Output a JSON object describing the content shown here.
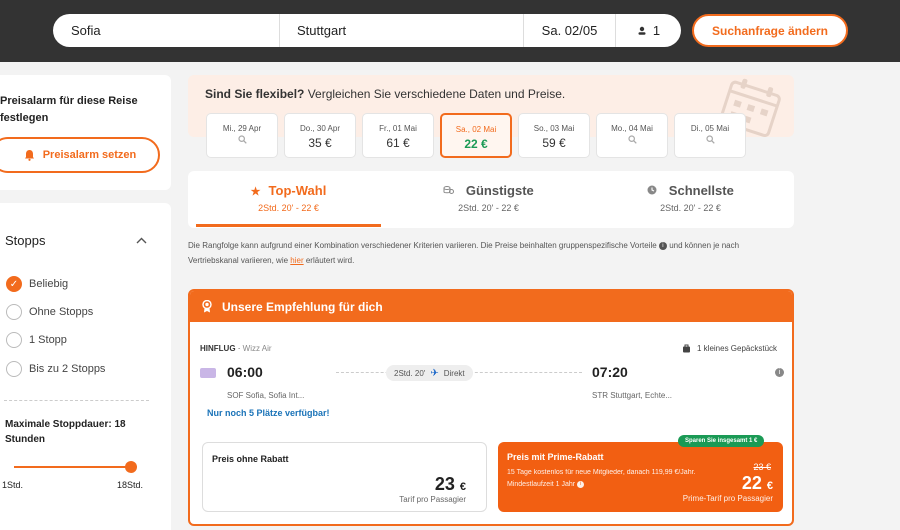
{
  "search": {
    "from": "Sofia",
    "to": "Stuttgart",
    "date": "Sa. 02/05",
    "passengers": "1",
    "change_label": "Suchanfrage ändern"
  },
  "alarm": {
    "title": "Preisalarm für diese Reise festlegen",
    "button": "Preisalarm setzen"
  },
  "filters": {
    "stops_title": "Stopps",
    "options": [
      "Beliebig",
      "Ohne Stopps",
      "1 Stopp",
      "Bis zu 2 Stopps"
    ],
    "selected": "Beliebig",
    "max_duration_label": "Maximale Stoppdauer: 18 Stunden",
    "slider_min": "1Std.",
    "slider_max": "18Std.",
    "slider_value_hours": 18
  },
  "flex": {
    "title_bold": "Sind Sie flexibel?",
    "title_rest": "Vergleichen Sie verschiedene Daten und Preise.",
    "days": [
      {
        "date": "Mi., 29 Apr",
        "price": "",
        "selected": false
      },
      {
        "date": "Do., 30 Apr",
        "price": "35 €",
        "selected": false
      },
      {
        "date": "Fr., 01 Mai",
        "price": "61 €",
        "selected": false
      },
      {
        "date": "Sa., 02 Mai",
        "price": "22 €",
        "selected": true
      },
      {
        "date": "So., 03 Mai",
        "price": "59 €",
        "selected": false
      },
      {
        "date": "Mo., 04 Mai",
        "price": "",
        "selected": false
      },
      {
        "date": "Di., 05 Mai",
        "price": "",
        "selected": false
      }
    ]
  },
  "tabs": [
    {
      "label": "Top-Wahl",
      "sub": "2Std. 20' - 22 €",
      "icon": "star-icon"
    },
    {
      "label": "Günstigste",
      "sub": "2Std. 20' - 22 €",
      "icon": "coins-icon"
    },
    {
      "label": "Schnellste",
      "sub": "2Std. 20' - 22 €",
      "icon": "clock-icon"
    }
  ],
  "note": {
    "text1": "Die Rangfolge kann aufgrund einer Kombination verschiedener Kriterien variieren. Die Preise beinhalten gruppenspezifische Vorteile",
    "text2": "und können je nach Vertriebskanal variieren, wie",
    "link": "hier",
    "text3": "erläutert wird."
  },
  "recommendation": {
    "header": "Unsere Empfehlung für dich",
    "direction": "HINFLUG",
    "airline": "Wizz Air",
    "baggage": "1 kleines Gepäckstück",
    "dep_time": "06:00",
    "arr_time": "07:20",
    "duration": "2Std. 20'",
    "stops": "Direkt",
    "dep_airport": "SOF Sofia, Sofia Int...",
    "arr_airport": "STR Stuttgart, Echte...",
    "seats_left": "Nur noch 5 Plätze verfügbar!",
    "standard": {
      "label": "Preis ohne Rabatt",
      "price": "23",
      "currency": "€",
      "sub": "Tarif pro Passagier"
    },
    "prime": {
      "badge": "Sparen Sie insgesamt 1 €",
      "label": "Preis mit Prime-Rabatt",
      "desc": "15 Tage kostenlos für neue Mitglieder, danach 119,99 €/Jahr. Mindestlaufzeit 1 Jahr",
      "old_price": "23 €",
      "price": "22",
      "currency": "€",
      "sub": "Prime-Tarif pro Passagier"
    }
  },
  "colors": {
    "accent": "#f26b1d",
    "topbar": "#333333",
    "green": "#1a9a55"
  }
}
